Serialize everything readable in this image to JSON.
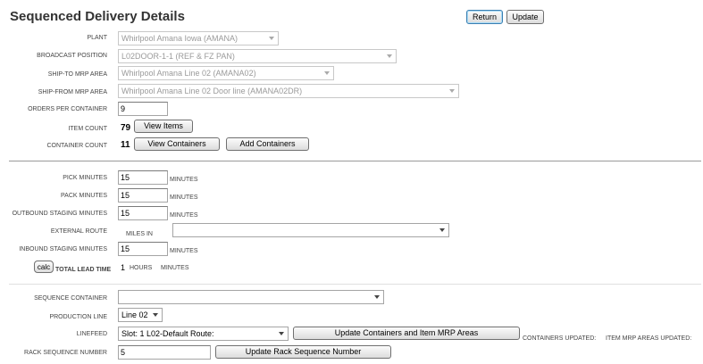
{
  "page_title": "Sequenced Delivery Details",
  "buttons": {
    "return": "Return",
    "update": "Update",
    "view_items": "View Items",
    "view_containers": "View Containers",
    "add_containers": "Add Containers",
    "calc": "calc",
    "update_containers_mrp": "Update Containers and  Item MRP Areas",
    "update_rack_sequence": "Update Rack Sequence Number"
  },
  "details": {
    "plant_label": "Plant",
    "plant_value": "Whirlpool Amana Iowa (AMANA)",
    "broadcast_label": "Broadcast Position",
    "broadcast_value": "L02DOOR-1-1 (REF & FZ PAN)",
    "ship_to_label": "Ship-To MRP Area",
    "ship_to_value": "Whirlpool Amana Line 02 (AMANA02)",
    "ship_from_label": "Ship-From MRP Area",
    "ship_from_value": "Whirlpool Amana Line 02 Door line (AMANA02DR)",
    "orders_label": "Orders per Container",
    "orders_value": "9",
    "item_count_label": "Item Count",
    "item_count_value": "79",
    "container_count_label": "Container Count",
    "container_count_value": "11"
  },
  "timing": {
    "pick_label": "Pick Minutes",
    "pick_value": "15",
    "pack_label": "Pack Minutes",
    "pack_value": "15",
    "outbound_label": "Outbound Staging Minutes",
    "outbound_value": "15",
    "external_label": "External Route",
    "miles_in_label": "Miles in",
    "external_value": "",
    "inbound_label": "Inbound Staging Minutes",
    "inbound_value": "15",
    "minutes_unit": "Minutes",
    "total_label": "Total Lead Time",
    "total_value": "1",
    "hours_unit": "Hours",
    "total_minutes_unit": "Minutes"
  },
  "sequence": {
    "container_label": "Sequence Container",
    "container_value": "",
    "production_line_label": "Production Line",
    "production_line_value": "Line 02",
    "linefeed_label": "Linefeed",
    "linefeed_value": "Slot: 1 L02-Default Route:",
    "containers_updated_label": "Containers Updated:",
    "item_mrp_updated_label": "Item MRP Areas Updated:",
    "rack_label": "Rack Sequence Number",
    "rack_value": "5"
  }
}
